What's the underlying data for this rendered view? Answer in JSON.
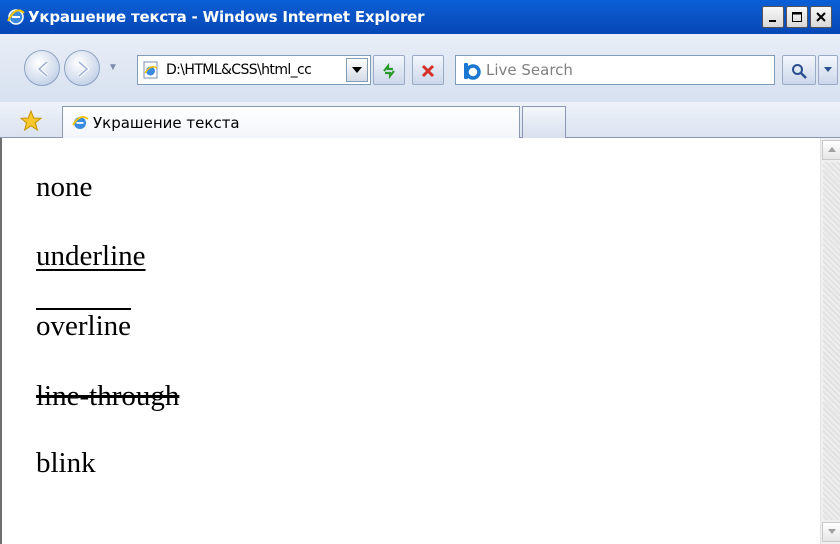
{
  "window": {
    "title": "Украшение текста - Windows Internet Explorer",
    "accent": "#0a5fd6"
  },
  "navbar": {
    "address_url": "D:\\HTML&CSS\\html_cc",
    "search_placeholder": "Live Search"
  },
  "tabs": [
    {
      "label": "Украшение текста",
      "active": true
    }
  ],
  "content": {
    "lines": [
      {
        "text": "none",
        "decoration": "none"
      },
      {
        "text": "underline",
        "decoration": "underline"
      },
      {
        "text": "overline",
        "decoration": "overline"
      },
      {
        "text": "line-through",
        "decoration": "line-through"
      },
      {
        "text": "blink",
        "decoration": "blink"
      }
    ]
  },
  "icons": [
    "ie-logo-icon",
    "back-icon",
    "forward-icon",
    "page-icon",
    "refresh-icon",
    "stop-icon",
    "live-search-icon",
    "search-magnifier-icon",
    "favorites-star-icon",
    "minimize-icon",
    "maximize-icon",
    "close-icon"
  ]
}
